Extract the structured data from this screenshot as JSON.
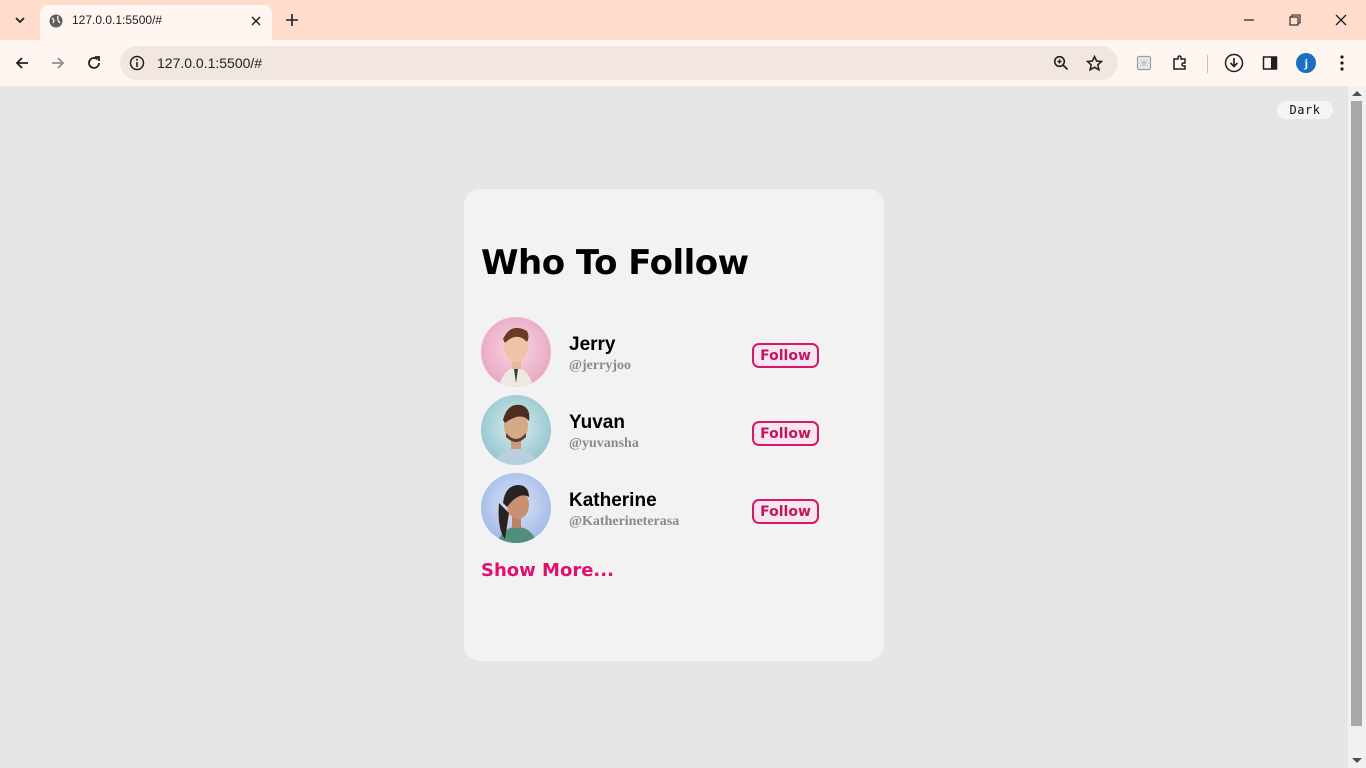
{
  "browser": {
    "tab_title": "127.0.0.1:5500/#",
    "url": "127.0.0.1:5500/#",
    "profile_initial": "j"
  },
  "page": {
    "theme_toggle_label": "Dark",
    "card_title": "Who To Follow",
    "users": [
      {
        "name": "Jerry",
        "handle": "@jerryjoo",
        "button_label": "Follow"
      },
      {
        "name": "Yuvan",
        "handle": "@yuvansha",
        "button_label": "Follow"
      },
      {
        "name": "Katherine",
        "handle": "@Katherineterasa",
        "button_label": "Follow"
      }
    ],
    "show_more_label": "Show More..."
  },
  "colors": {
    "accent": "#e0106e",
    "page_bg": "#e6e6e6",
    "card_bg": "#f2f2f2",
    "tab_strip": "#ffdccb"
  }
}
